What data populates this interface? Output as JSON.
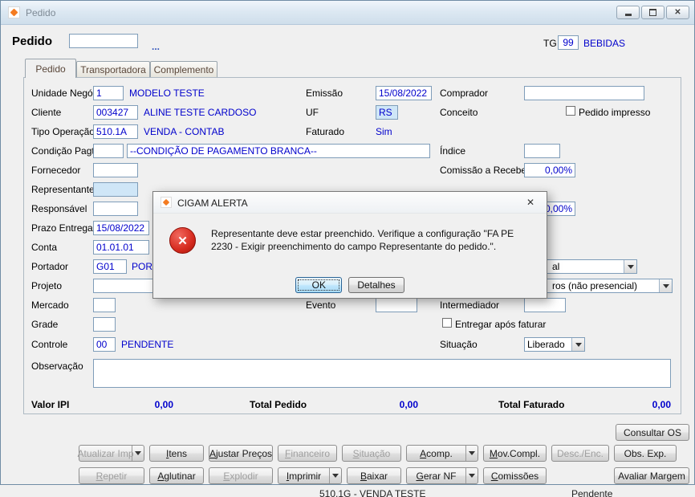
{
  "window": {
    "title": "Pedido"
  },
  "icons": {
    "close": "✕"
  },
  "header": {
    "pedido_label": "Pedido",
    "pedido_value": "",
    "lookup": "...",
    "tg_label": "TG",
    "tg_value": "99",
    "tg_desc": "BEBIDAS"
  },
  "tabs": {
    "pedido": "Pedido",
    "transportadora": "Transportadora",
    "complemento": "Complemento"
  },
  "form": {
    "unidade_negocio": {
      "label": "Unidade Negócio",
      "value": "1",
      "desc": "MODELO TESTE"
    },
    "cliente": {
      "label": "Cliente",
      "value": "003427",
      "desc": "ALINE TESTE CARDOSO"
    },
    "tipo_operacao": {
      "label": "Tipo Operação",
      "value": "510.1A",
      "desc": "VENDA - CONTAB"
    },
    "condicao_pagto": {
      "label": "Condição Pagto.",
      "value": "",
      "desc_value": "--CONDIÇÃO DE PAGAMENTO BRANCA--"
    },
    "fornecedor": {
      "label": "Fornecedor",
      "value": ""
    },
    "representante": {
      "label": "Representante",
      "value": ""
    },
    "responsavel": {
      "label": "Responsável",
      "value": ""
    },
    "prazo_entrega": {
      "label": "Prazo Entrega",
      "value": "15/08/2022"
    },
    "conta": {
      "label": "Conta",
      "value": "01.01.01"
    },
    "portador": {
      "label": "Portador",
      "value": "G01",
      "desc": "PORTAD"
    },
    "projeto": {
      "label": "Projeto",
      "value": ""
    },
    "mercado": {
      "label": "Mercado",
      "value": ""
    },
    "evento": {
      "label": "Evento",
      "value": ""
    },
    "intermediador": {
      "label": "Intermediador",
      "value": ""
    },
    "grade": {
      "label": "Grade",
      "value": ""
    },
    "entregar_apos_faturar": {
      "label": "Entregar após faturar"
    },
    "controle": {
      "label": "Controle",
      "value": "00",
      "desc": "PENDENTE"
    },
    "situacao": {
      "label": "Situação",
      "value": "Liberado"
    },
    "observacao": {
      "label": "Observação",
      "value": ""
    },
    "emissao": {
      "label": "Emissão",
      "value": "15/08/2022"
    },
    "uf": {
      "label": "UF",
      "value": "RS"
    },
    "faturado": {
      "label": "Faturado",
      "value": "Sim"
    },
    "comprador": {
      "label": "Comprador",
      "value": ""
    },
    "conceito": {
      "label": "Conceito"
    },
    "pedido_impresso": {
      "label": "Pedido impresso"
    },
    "indice": {
      "label": "Índice",
      "value": ""
    },
    "comissao_receber": {
      "label": "Comissão a Receber",
      "value": "0,00%"
    },
    "percent_field_2": {
      "value": "0,00%"
    },
    "dropdown_partial_1": {
      "visible_text": "al"
    },
    "dropdown_partial_2": {
      "visible_text": "ros (não presencial)"
    }
  },
  "totals": {
    "valor_ipi_label": "Valor IPI",
    "valor_ipi": "0,00",
    "total_pedido_label": "Total Pedido",
    "total_pedido": "0,00",
    "total_faturado_label": "Total Faturado",
    "total_faturado": "0,00"
  },
  "buttons": {
    "consultar_os": "Consultar OS",
    "atualizar_imp": "Atualizar Imp",
    "itens": "Itens",
    "ajustar_precos": "Ajustar Preços",
    "financeiro": "Financeiro",
    "situacao": "Situação",
    "acomp": "Acomp.",
    "mov_compl": "Mov.Compl.",
    "desc_enc": "Desc./Enc.",
    "obs_exp": "Obs. Exp.",
    "repetir": "Repetir",
    "aglutinar": "Aglutinar",
    "explodir": "Explodir",
    "imprimir": "Imprimir",
    "baixar": "Baixar",
    "gerar_nf": "Gerar NF",
    "comissoes": "Comissões",
    "avaliar_margem": "Avaliar Margem"
  },
  "footer": {
    "left": "510.1G - VENDA TESTE",
    "right": "Pendente"
  },
  "dialog": {
    "title": "CIGAM ALERTA",
    "message": "Representante deve estar preenchido. Verifique a configuração \"FA PE 2230 - Exigir preenchimento do campo Representante do pedido.\".",
    "ok": "OK",
    "detalhes": "Detalhes"
  },
  "colors": {
    "value_blue": "#0000cc",
    "field_highlight": "#cfe6f7",
    "error_red": "#d62b1f",
    "brand_orange": "#f47b20"
  }
}
